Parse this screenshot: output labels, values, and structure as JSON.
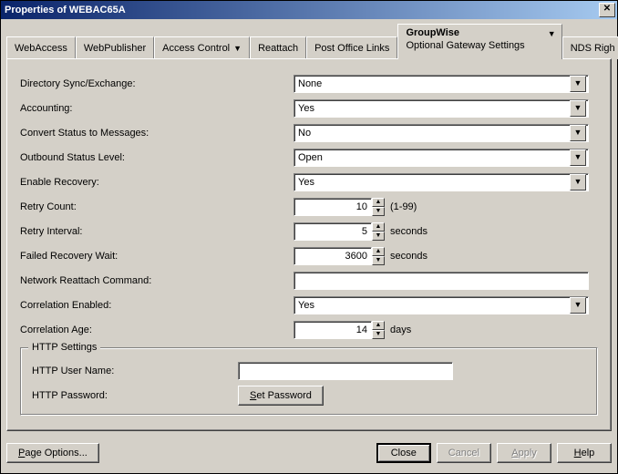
{
  "window": {
    "title": "Properties of WEBAC65A"
  },
  "tabs": {
    "items": [
      {
        "label": "WebAccess"
      },
      {
        "label": "WebPublisher"
      },
      {
        "label": "Access Control",
        "dropdown": true
      },
      {
        "label": "Reattach"
      },
      {
        "label": "Post Office Links"
      },
      {
        "label": "GroupWise",
        "subtitle": "Optional Gateway Settings",
        "dropdown": true,
        "active": true
      },
      {
        "label": "NDS Righ"
      }
    ]
  },
  "form": {
    "directory_sync_exchange": {
      "label": "Directory Sync/Exchange:",
      "value": "None"
    },
    "accounting": {
      "label": "Accounting:",
      "value": "Yes"
    },
    "convert_status": {
      "label": "Convert Status to Messages:",
      "value": "No"
    },
    "outbound_status": {
      "label": "Outbound Status Level:",
      "value": "Open"
    },
    "enable_recovery": {
      "label": "Enable Recovery:",
      "value": "Yes"
    },
    "retry_count": {
      "label": "Retry Count:",
      "value": "10",
      "unit": "(1-99)"
    },
    "retry_interval": {
      "label": "Retry Interval:",
      "value": "5",
      "unit": "seconds"
    },
    "failed_recovery_wait": {
      "label": "Failed Recovery Wait:",
      "value": "3600",
      "unit": "seconds"
    },
    "network_reattach": {
      "label": "Network Reattach Command:",
      "value": ""
    },
    "correlation_enabled": {
      "label": "Correlation Enabled:",
      "value": "Yes"
    },
    "correlation_age": {
      "label": "Correlation Age:",
      "value": "14",
      "unit": "days"
    }
  },
  "http_group": {
    "legend": "HTTP Settings",
    "user_name": {
      "label": "HTTP User Name:",
      "value": ""
    },
    "password": {
      "label": "HTTP Password:",
      "button": "Set Password"
    }
  },
  "buttons": {
    "page_options": "Page Options...",
    "close": "Close",
    "cancel": "Cancel",
    "apply": "Apply",
    "help": "Help"
  }
}
